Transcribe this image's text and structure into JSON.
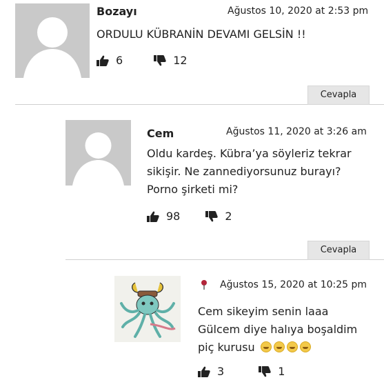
{
  "comments": [
    {
      "author": "Bozayı",
      "date": "Ağustos 10, 2020 at 2:53 pm",
      "text": "ORDULU KÜBRANİN DEVAMI GELSİN !!",
      "likes": "6",
      "dislikes": "12",
      "reply_label": "Cevapla"
    },
    {
      "author": "Cem",
      "date": "Ağustos 11, 2020 at 3:26 am",
      "text_lines": [
        "Oldu kardeş. Kübra’ya söyleriz tekrar",
        "sikişir. Ne zannediyorsunuz burayı?",
        "Porno şirketi mi?"
      ],
      "likes": "98",
      "dislikes": "2",
      "reply_label": "Cevapla"
    },
    {
      "author": "",
      "date": "Ağustos 15, 2020 at 10:25 pm",
      "text_lines": [
        "Cem sikeyim senin laaa",
        "Gülcem diye halıya boşaldim",
        "piç kurusu"
      ],
      "likes": "3",
      "dislikes": "1"
    }
  ],
  "icons": {
    "like": "thumbs-up-icon",
    "dislike": "thumbs-down-icon",
    "pin": "map-pin-icon",
    "emoji": "grinning-face-emoji"
  }
}
